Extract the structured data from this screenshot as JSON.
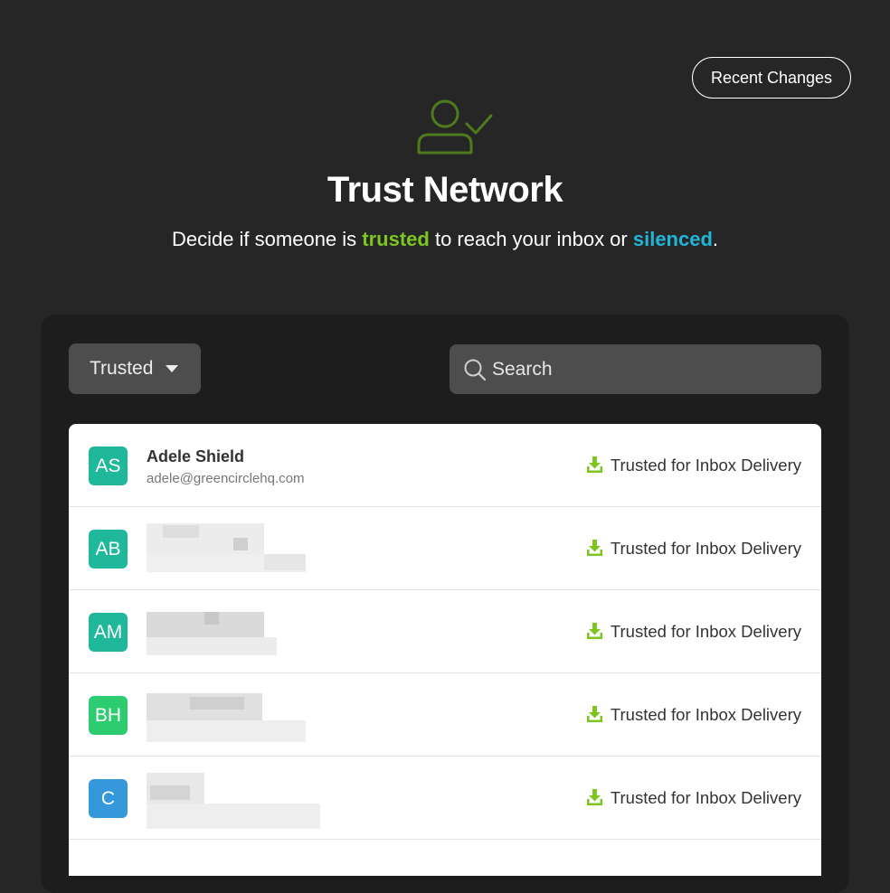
{
  "header": {
    "recent_changes_label": "Recent Changes",
    "icon": "user-check-icon",
    "title": "Trust Network",
    "subtitle_before": "Decide if someone is ",
    "subtitle_trusted": "trusted",
    "subtitle_middle": " to reach your inbox or ",
    "subtitle_silenced": "silenced",
    "subtitle_after": "."
  },
  "colors": {
    "background": "#262626",
    "panel": "#1d1d1d",
    "accent_trusted": "#7dc51f",
    "accent_silenced": "#21b5d8",
    "icon_green": "#4f7a1e"
  },
  "filter": {
    "selected": "Trusted"
  },
  "search": {
    "placeholder": "Search",
    "value": ""
  },
  "contacts": [
    {
      "initials": "AS",
      "name": "Adele Shield",
      "email": "adele@greencirclehq.com",
      "status": "Trusted for Inbox Delivery",
      "avatar_color": "#1fb89b"
    },
    {
      "initials": "AB",
      "name": "",
      "email": "",
      "status": "Trusted for Inbox Delivery",
      "avatar_color": "#1fb89b"
    },
    {
      "initials": "AM",
      "name": "",
      "email": "",
      "status": "Trusted for Inbox Delivery",
      "avatar_color": "#1fb89b"
    },
    {
      "initials": "BH",
      "name": "",
      "email": "",
      "status": "Trusted for Inbox Delivery",
      "avatar_color": "#2ecc71"
    },
    {
      "initials": "C",
      "name": "",
      "email": "",
      "status": "Trusted for Inbox Delivery",
      "avatar_color": "#3498db"
    }
  ]
}
